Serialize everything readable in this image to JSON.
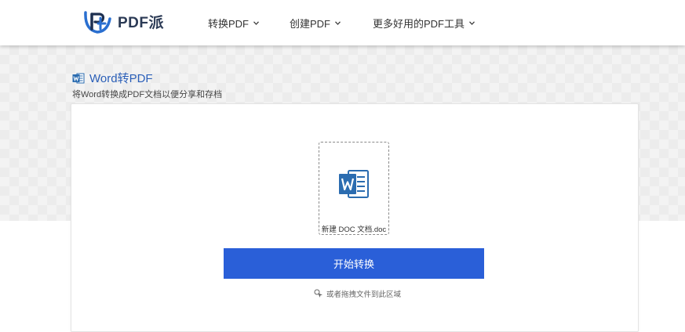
{
  "header": {
    "logo_text": "PDF派",
    "nav": [
      {
        "label": "转换PDF"
      },
      {
        "label": "创建PDF"
      },
      {
        "label": "更多好用的PDF工具"
      }
    ]
  },
  "page": {
    "title": "Word转PDF",
    "subtitle": "将Word转换成PDF文档以便分享和存档"
  },
  "upload": {
    "file_name": "新建 DOC 文档.doc",
    "convert_button": "开始转换",
    "drag_hint": "或者拖拽文件到此区域"
  },
  "colors": {
    "accent": "#2a5fd8",
    "title_blue": "#2b5fb8",
    "word_blue": "#2b6cb0"
  },
  "icons": {
    "logo": "pdfpai-logo-icon",
    "title": "word-icon",
    "file": "word-document-icon",
    "hint": "drag-cursor-icon",
    "nav_chevron": "chevron-down-icon"
  }
}
